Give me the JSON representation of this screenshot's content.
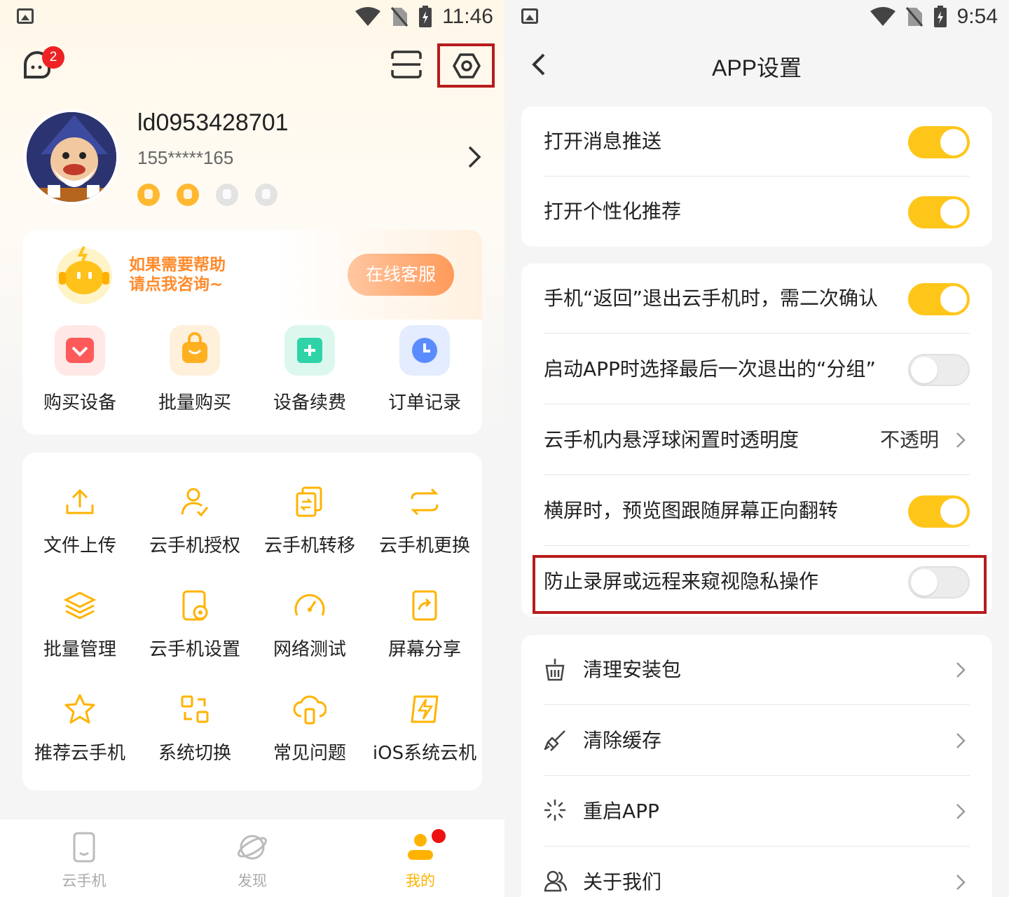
{
  "left": {
    "status": {
      "time": "11:46"
    },
    "header": {
      "badge_count": "2"
    },
    "profile": {
      "username": "ld0953428701",
      "phone": "155*****165"
    },
    "help": {
      "line1": "如果需要帮助",
      "line2": "请点我咨询~",
      "button": "在线客服"
    },
    "shop_items": [
      {
        "label": "购买设备",
        "icon": "diamond-icon",
        "color": "#ff5a5a"
      },
      {
        "label": "批量购买",
        "icon": "shopping-bag-icon",
        "color": "#ffb020"
      },
      {
        "label": "设备续费",
        "icon": "plus-icon",
        "color": "#2fd3a8"
      },
      {
        "label": "订单记录",
        "icon": "clock-icon",
        "color": "#5a8cff"
      }
    ],
    "tools": [
      {
        "label": "文件上传",
        "icon": "upload-icon"
      },
      {
        "label": "云手机授权",
        "icon": "user-check-icon"
      },
      {
        "label": "云手机转移",
        "icon": "transfer-icon"
      },
      {
        "label": "云手机更换",
        "icon": "swap-icon"
      },
      {
        "label": "批量管理",
        "icon": "layers-icon"
      },
      {
        "label": "云手机设置",
        "icon": "phone-settings-icon"
      },
      {
        "label": "网络测试",
        "icon": "speedometer-icon"
      },
      {
        "label": "屏幕分享",
        "icon": "share-icon"
      },
      {
        "label": "推荐云手机",
        "icon": "star-icon"
      },
      {
        "label": "系统切换",
        "icon": "system-switch-icon"
      },
      {
        "label": "常见问题",
        "icon": "cloud-phone-icon"
      },
      {
        "label": "iOS系统云机",
        "icon": "bolt-icon"
      }
    ],
    "tabs": [
      {
        "label": "云手机",
        "icon": "phone-icon",
        "active": false
      },
      {
        "label": "发现",
        "icon": "planet-icon",
        "active": false
      },
      {
        "label": "我的",
        "icon": "profile-icon",
        "active": true
      }
    ],
    "accent": "#ffb300"
  },
  "right": {
    "status": {
      "time": "9:54"
    },
    "title": "APP设置",
    "group1": [
      {
        "label": "打开消息推送",
        "toggle": "on"
      },
      {
        "label": "打开个性化推荐",
        "toggle": "on"
      }
    ],
    "group2": [
      {
        "label": "手机“返回”退出云手机时，需二次确认",
        "toggle": "on"
      },
      {
        "label": "启动APP时选择最后一次退出的“分组”",
        "toggle": "off"
      },
      {
        "label": "云手机内悬浮球闲置时透明度",
        "value": "不透明"
      },
      {
        "label": "横屏时，预览图跟随屏幕正向翻转",
        "toggle": "on"
      },
      {
        "label": "防止录屏或远程来窥视隐私操作",
        "toggle": "off"
      }
    ],
    "group3": [
      {
        "label": "清理安装包",
        "icon": "basket-icon"
      },
      {
        "label": "清除缓存",
        "icon": "brush-icon"
      },
      {
        "label": "重启APP",
        "icon": "loading-icon"
      },
      {
        "label": "关于我们",
        "icon": "users-icon"
      }
    ],
    "toggle_on_color": "#ffc61a"
  }
}
